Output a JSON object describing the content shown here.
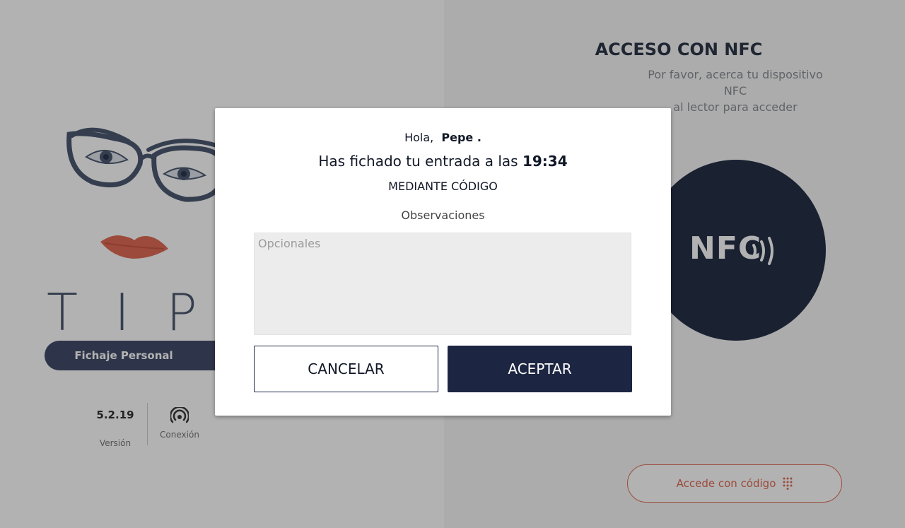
{
  "brand": {
    "logo_text": "TIPSY",
    "subtitle": "Fichaje Personal"
  },
  "info": {
    "version_value": "5.2.19",
    "version_label": "Versión",
    "connection_icon": "wifi-signal-icon",
    "connection_label": "Conexión"
  },
  "nfc": {
    "title": "ACCESO CON NFC",
    "subtitle_line1": "Por favor, acerca tu dispositivo NFC",
    "subtitle_line2": "al lector para acceder",
    "circle_label": "NFC",
    "code_button_label": "Accede con código",
    "code_button_icon": "keypad-icon"
  },
  "modal": {
    "greeting_prefix": "Hola,",
    "user_name": "Pepe .",
    "entry_text": "Has fichado tu entrada a las",
    "entry_time": "19:34",
    "method": "MEDIANTE CÓDIGO",
    "observations_label": "Observaciones",
    "observations_value": "",
    "observations_placeholder": "Opcionales",
    "cancel_label": "CANCELAR",
    "accept_label": "ACEPTAR"
  },
  "colors": {
    "navy": "#1c2541",
    "accent": "#e06b55",
    "nfc_circle": "#263047"
  }
}
